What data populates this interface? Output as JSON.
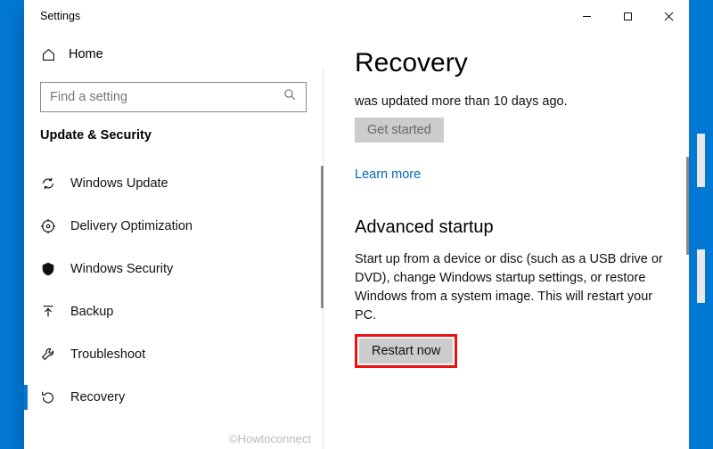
{
  "titlebar": {
    "app": "Settings"
  },
  "sidebar": {
    "home": "Home",
    "search_placeholder": "Find a setting",
    "section": "Update & Security",
    "items": [
      {
        "label": "Windows Update"
      },
      {
        "label": "Delivery Optimization"
      },
      {
        "label": "Windows Security"
      },
      {
        "label": "Backup"
      },
      {
        "label": "Troubleshoot"
      },
      {
        "label": "Recovery"
      }
    ]
  },
  "main": {
    "title": "Recovery",
    "truncated_line": "was updated more than 10 days ago.",
    "get_started": "Get started",
    "learn_more": "Learn more",
    "adv_heading": "Advanced startup",
    "adv_desc": "Start up from a device or disc (such as a USB drive or DVD), change Windows startup settings, or restore Windows from a system image. This will restart your PC.",
    "restart": "Restart now"
  },
  "watermark": "©Howtoconnect"
}
